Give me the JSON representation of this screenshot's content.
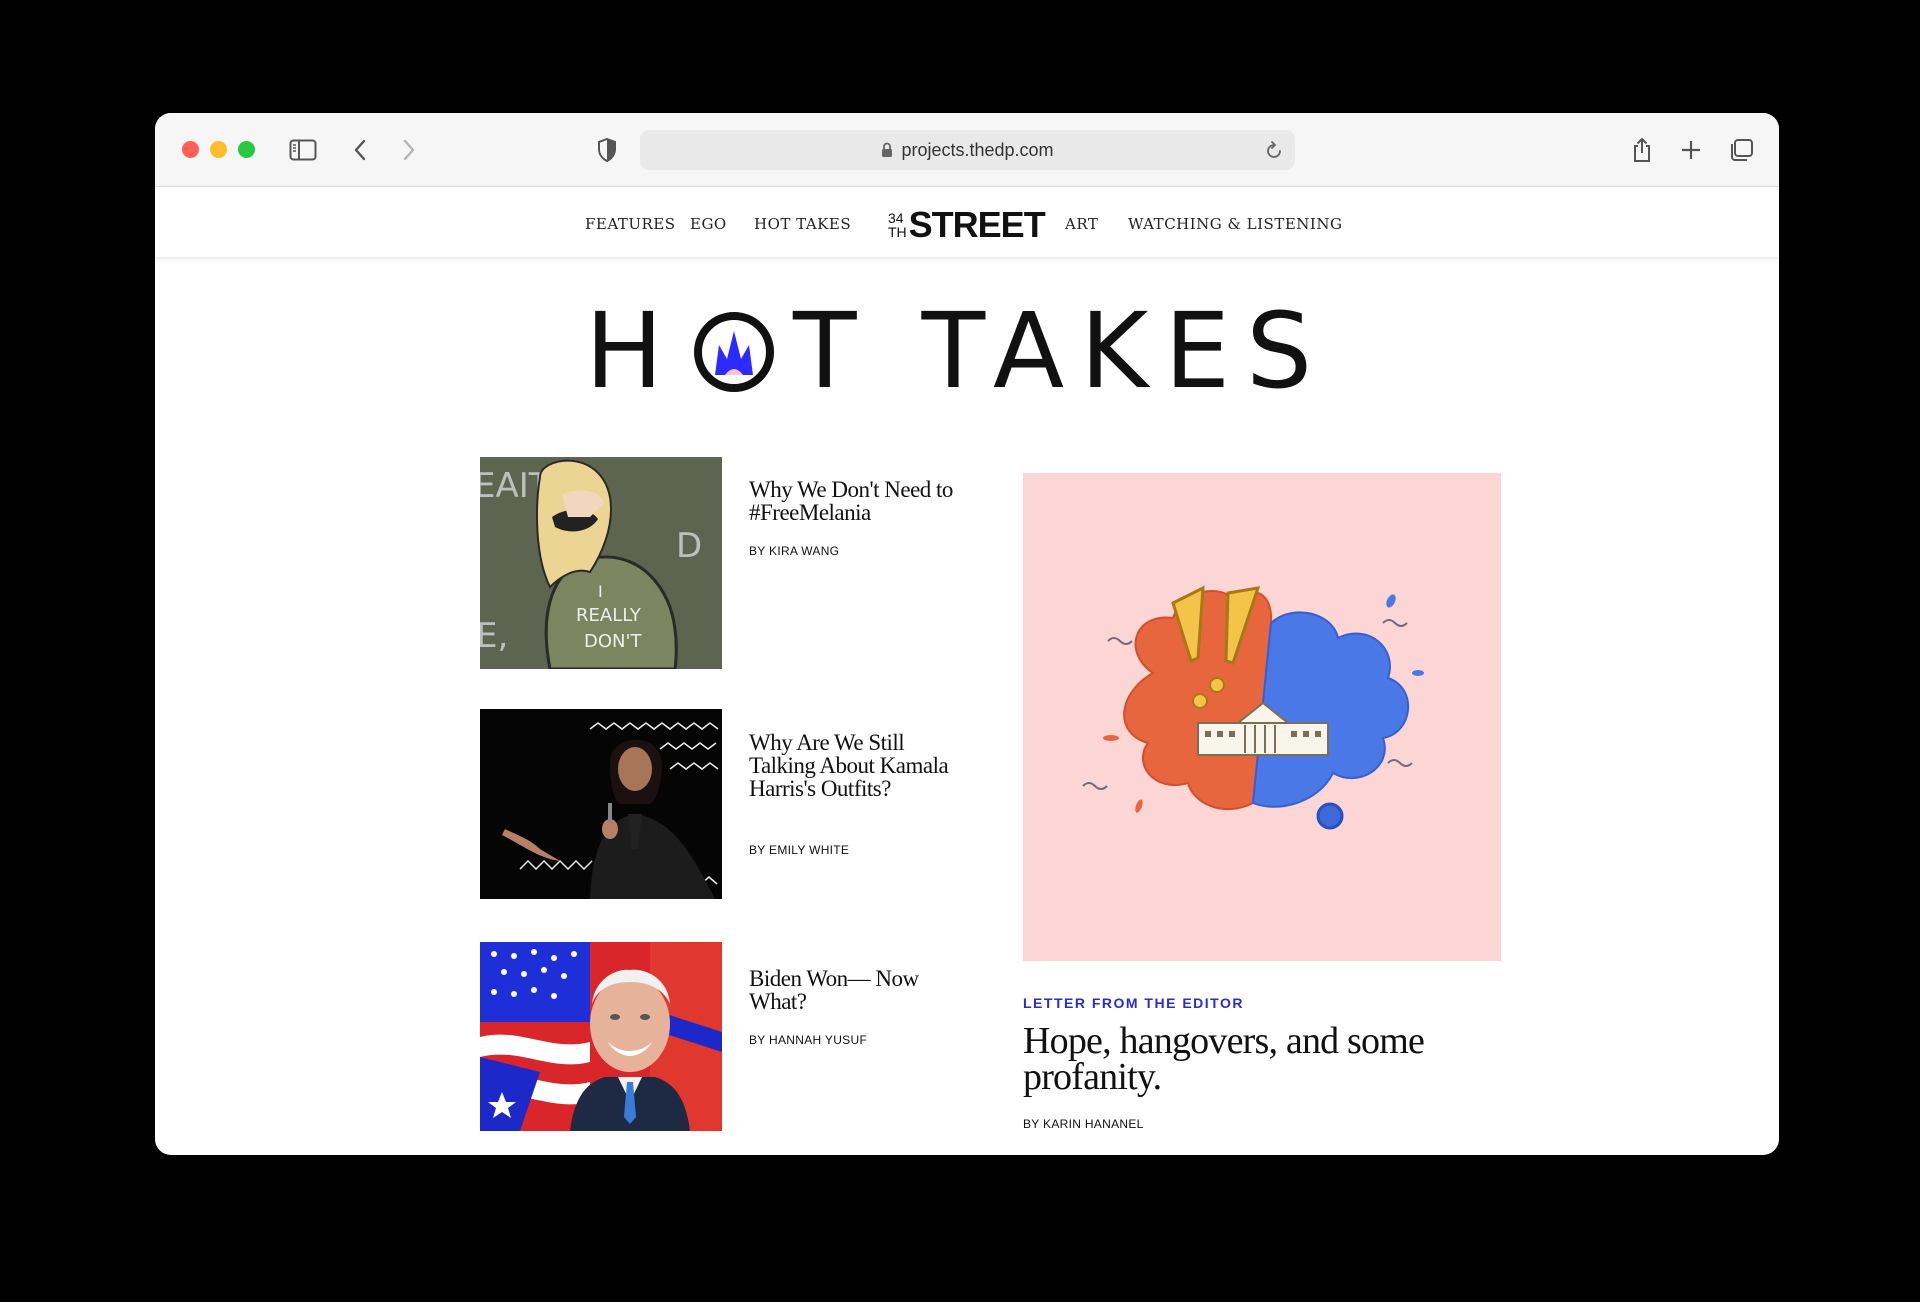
{
  "browser": {
    "url": "projects.thedp.com"
  },
  "nav": {
    "items": [
      "FEATURES",
      "EGO",
      "HOT TAKES",
      "ART",
      "WATCHING & LISTENING"
    ],
    "logo_number_top": "34",
    "logo_number_bottom": "TH",
    "logo_word": "STREET"
  },
  "hero": {
    "title_left": "H",
    "title_right": "T TAKES"
  },
  "articles": [
    {
      "title": "Why We Don't Need to #FreeMelania",
      "byline": "BY KIRA WANG"
    },
    {
      "title": "Why Are We Still Talking About Kamala Harris's Outfits?",
      "byline": "BY EMILY WHITE"
    },
    {
      "title": "Biden Won— Now What?",
      "byline": "BY HANNAH YUSUF"
    }
  ],
  "feature": {
    "kicker": "LETTER FROM THE EDITOR",
    "title": "Hope, hangovers, and some profanity.",
    "byline": "BY KARIN HANANEL"
  },
  "colors": {
    "accent_blue": "#2a2ad8",
    "feature_bg": "#fcd5d5",
    "flame_blue": "#2b2bff"
  }
}
